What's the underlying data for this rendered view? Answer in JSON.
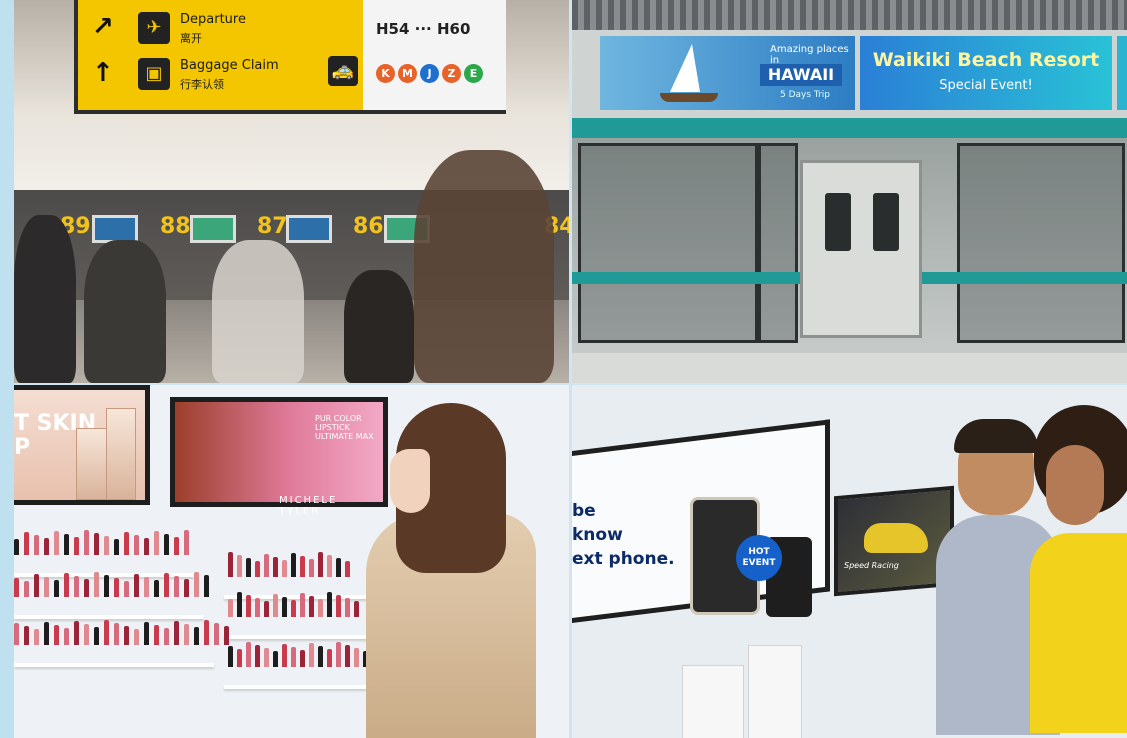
{
  "airport": {
    "departure_en": "Departure",
    "departure_zh": "离开",
    "baggage_en": "Baggage Claim",
    "baggage_zh": "行李认领",
    "gates": "H54 ··· H60",
    "lines": [
      {
        "letter": "K",
        "color": "#e8622a"
      },
      {
        "letter": "M",
        "color": "#e8622a"
      },
      {
        "letter": "J",
        "color": "#1f6fce"
      },
      {
        "letter": "Z",
        "color": "#e8622a"
      },
      {
        "letter": "E",
        "color": "#2aa84a"
      }
    ],
    "counters": [
      "89",
      "88",
      "87",
      "86",
      "84"
    ]
  },
  "metro": {
    "amazing": "Amazing places in",
    "hawaii": "HAWAII",
    "trip": "5 Days Trip",
    "resort": "Waikiki Beach Resort",
    "special": "Special Event!"
  },
  "cosmetics": {
    "skin_line1": "T SKIN",
    "skin_line2": "P",
    "lipstick_tag": "PUR COLOR LIPSTICK ULTIMATE MAX",
    "brand": "MICHELE TYLER"
  },
  "store": {
    "tagline_1": "be",
    "tagline_2": "know",
    "tagline_3": "ext phone.",
    "hot_1": "HOT",
    "hot_2": "EVENT",
    "racing": "Speed Racing"
  }
}
